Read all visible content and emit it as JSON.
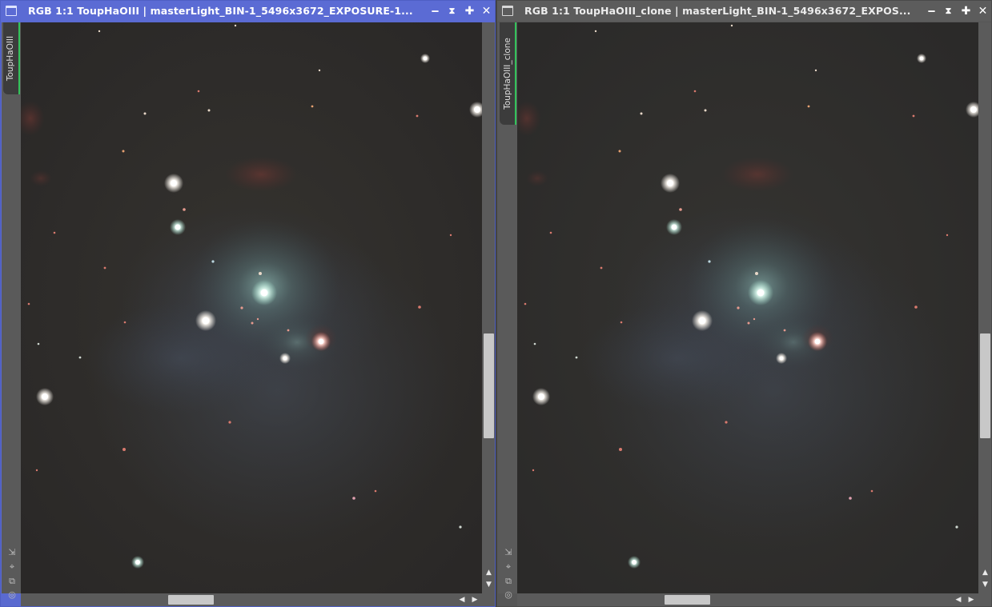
{
  "windows": [
    {
      "id": "left",
      "active": true,
      "title": "RGB 1:1 ToupHaOIII | masterLight_BIN-1_5496x3672_EXPOSURE-1...",
      "view_tab": "ToupHaOIII",
      "buttons": {
        "minimize": "‒",
        "shade": "⧗",
        "maximize": "✚",
        "close": "✕"
      }
    },
    {
      "id": "right",
      "active": false,
      "title": "RGB 1:1 ToupHaOIII_clone | masterLight_BIN-1_5496x3672_EXPOS...",
      "view_tab": "ToupHaOIII_clone",
      "buttons": {
        "minimize": "‒",
        "shade": "⧗",
        "maximize": "✚",
        "close": "✕"
      }
    }
  ],
  "tools": {
    "resize": "⇲",
    "fit": "⌖",
    "clone": "⧉",
    "target": "◎"
  },
  "scroll_arrows": {
    "up": "▲",
    "down": "▼",
    "left": "◀",
    "right": "▶"
  },
  "colors": {
    "active_title": "#5b6bd4",
    "inactive_title": "#5c5c5c",
    "background_sky": "#2d2b2a",
    "view_tab_accent": "#33c25a"
  }
}
